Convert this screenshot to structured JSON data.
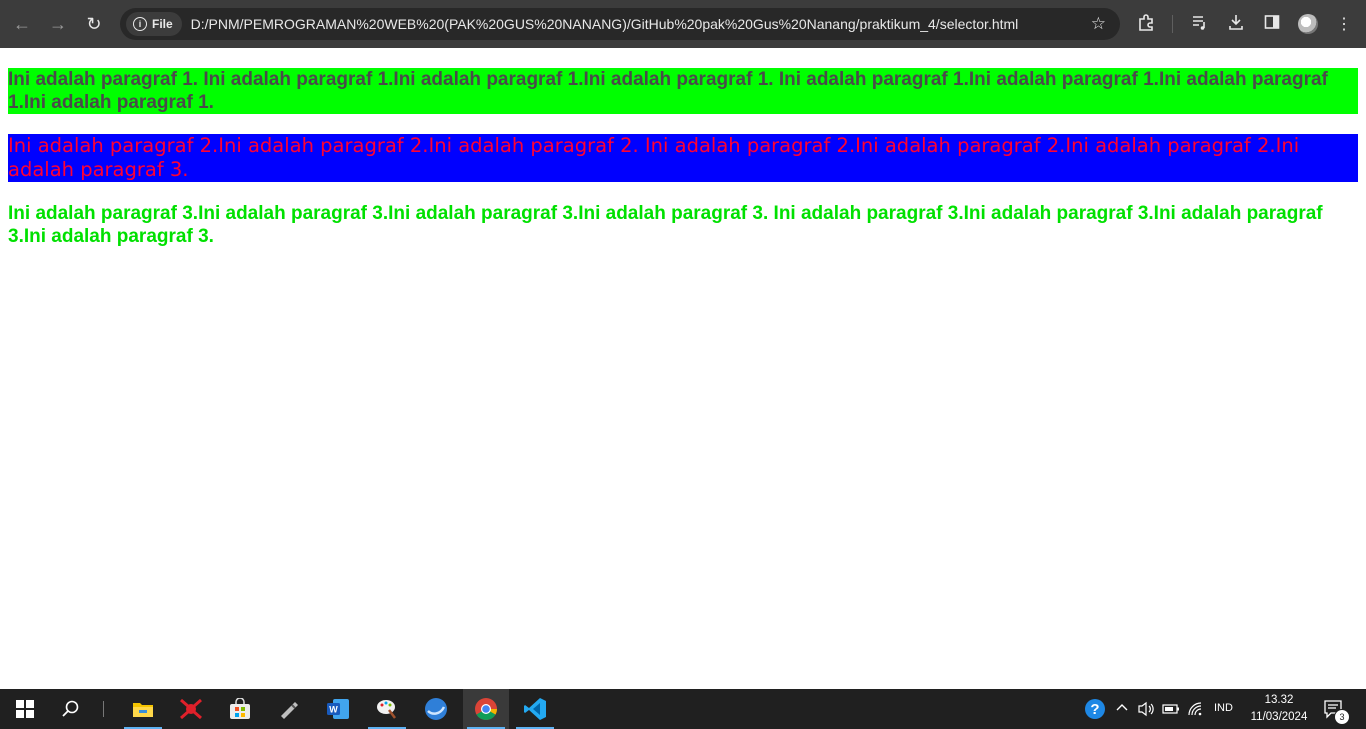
{
  "browser": {
    "back_icon": "arrow-left-icon",
    "forward_icon": "arrow-right-icon",
    "reload_icon": "reload-icon",
    "site_chip_label": "File",
    "url": "D:/PNM/PEMROGRAMAN%20WEB%20(PAK%20GUS%20NANANG)/GitHub%20pak%20Gus%20Nanang/praktikum_4/selector.html"
  },
  "page": {
    "paragraphs": [
      "Ini adalah paragraf 1. Ini adalah paragraf 1.Ini adalah paragraf 1.Ini adalah paragraf 1. Ini adalah paragraf 1.Ini adalah paragraf 1.Ini adalah paragraf 1.Ini adalah paragraf 1.",
      "Ini adalah paragraf 2.Ini adalah paragraf 2.Ini adalah paragraf 2. Ini adalah paragraf 2.Ini adalah paragraf 2.Ini adalah paragraf 2.Ini adalah paragraf 3.",
      "Ini adalah paragraf 3.Ini adalah paragraf 3.Ini adalah paragraf 3.Ini adalah paragraf 3. Ini adalah paragraf 3.Ini adalah paragraf 3.Ini adalah paragraf 3.Ini adalah paragraf 3."
    ],
    "colors": {
      "p1_bg": "#00ff00",
      "p1_text": "#4a4a4a",
      "p2_bg": "#0000ff",
      "p2_text": "#ff0033",
      "p3_text": "#00e000"
    }
  },
  "taskbar": {
    "apps": [
      "start-icon",
      "search-icon",
      "file-explorer-icon",
      "app-red-icon",
      "store-icon",
      "usb-tool-icon",
      "word-icon",
      "paint-icon",
      "app-blue-icon",
      "chrome-icon",
      "vscode-icon"
    ],
    "language": "IND",
    "time": "13.32",
    "date": "11/03/2024",
    "notification_count": "3"
  }
}
